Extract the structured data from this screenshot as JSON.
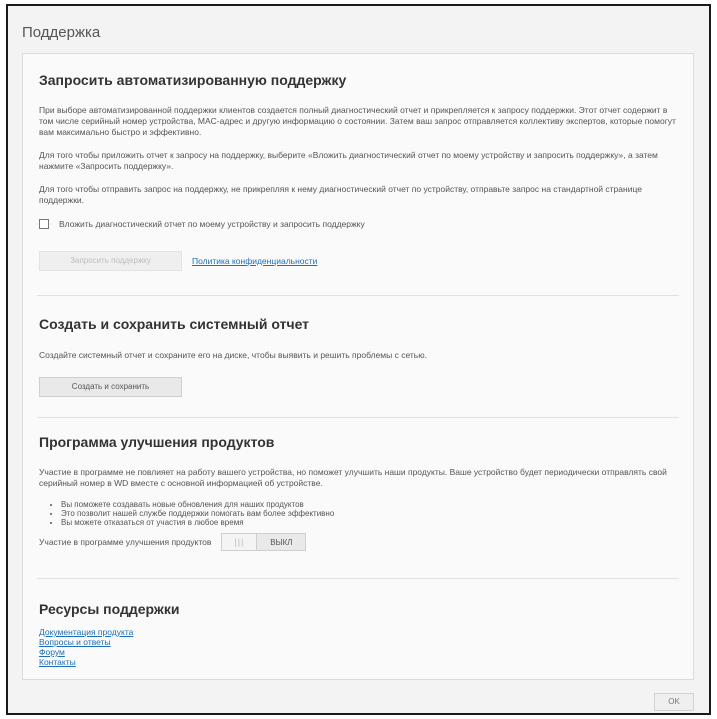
{
  "dialog": {
    "title": "Поддержка",
    "ok_label": "OK"
  },
  "auto_support": {
    "title": "Запросить автоматизированную поддержку",
    "para1": "При выборе автоматизированной поддержки клиентов создается полный диагностический отчет и прикрепляется к запросу поддержки. Этот отчет содержит в том числе серийный номер устройства, MAC-адрес и другую информацию о состоянии. Затем ваш запрос отправляется коллективу экспертов, которые помогут вам максимально быстро и эффективно.",
    "para2": "Для того чтобы приложить отчет к запросу на поддержку, выберите «Вложить диагностический отчет по моему устройству и запросить поддержку», а затем нажмите «Запросить поддержку».",
    "para3": "Для того чтобы отправить запрос на поддержку, не прикрепляя к нему диагностический отчет по устройству, отправьте запрос на стандартной странице поддержки.",
    "checkbox_label": "Вложить диагностический отчет по моему устройству и запросить поддержку",
    "checkbox_checked": false,
    "request_button": "Запросить поддержку",
    "privacy_link": "Политика конфиденциальности"
  },
  "system_report": {
    "title": "Создать и сохранить системный отчет",
    "para": "Создайте системный отчет и сохраните его на диске, чтобы выявить и решить проблемы с сетью.",
    "button": "Создать и сохранить"
  },
  "improvement": {
    "title": "Программа улучшения продуктов",
    "para": "Участие в программе не повлияет на работу вашего устройства, но поможет улучшить наши продукты. Ваше устройство будет периодически отправлять свой серийный номер в WD вместе с основной информацией об устройстве.",
    "bullets": [
      "Вы поможете создавать новые обновления для наших продуктов",
      "Это позволит нашей службе поддержки помогать вам более эффективно",
      "Вы можете отказаться от участия в любое время"
    ],
    "toggle_label": "Участие в программе улучшения продуктов",
    "toggle_grip": "|||",
    "toggle_state": "ВЫКЛ"
  },
  "resources": {
    "title": "Ресурсы поддержки",
    "links": [
      "Документация продукта",
      "Вопросы и ответы",
      "Форум",
      "Контакты"
    ]
  }
}
